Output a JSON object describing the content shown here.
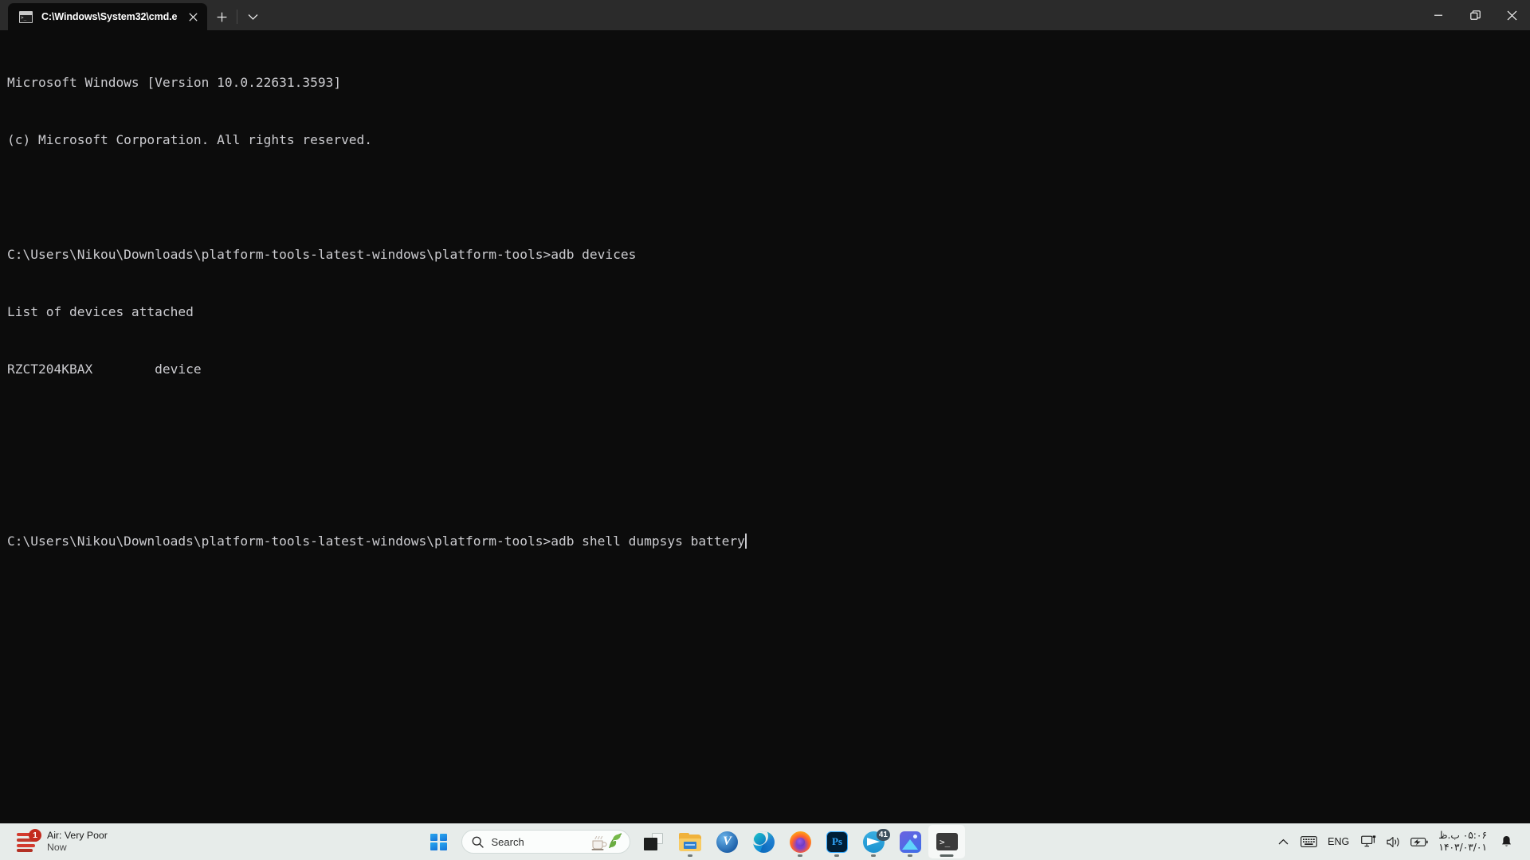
{
  "window": {
    "tab_title": "C:\\Windows\\System32\\cmd.e",
    "tab_icon": "console-icon",
    "new_tab_label": "+",
    "dropdown_label": "v",
    "minimize_label": "Minimize",
    "restore_label": "Restore",
    "close_label": "Close"
  },
  "terminal": {
    "lines": [
      "Microsoft Windows [Version 10.0.22631.3593]",
      "(c) Microsoft Corporation. All rights reserved.",
      "",
      "C:\\Users\\Nikou\\Downloads\\platform-tools-latest-windows\\platform-tools>adb devices",
      "List of devices attached",
      "RZCT204KBAX        device",
      "",
      ""
    ],
    "prompt": "C:\\Users\\Nikou\\Downloads\\platform-tools-latest-windows\\platform-tools>",
    "current_command": "adb shell dumpsys battery",
    "foreground_color": "#ccccd0",
    "background_color": "#0c0c0c"
  },
  "taskbar": {
    "background_color": "#e7ecea",
    "weather": {
      "title": "Air: Very Poor",
      "subtitle": "Now",
      "badge": "1",
      "icon": "haze-icon"
    },
    "start_label": "Start",
    "search": {
      "placeholder": "Search",
      "icon": "search-icon",
      "art": "teacup-and-leaf-illustration"
    },
    "apps": [
      {
        "name": "task-view",
        "label": "Task View",
        "running": false,
        "active": false,
        "badge": ""
      },
      {
        "name": "file-explorer",
        "label": "File Explorer",
        "running": true,
        "active": false,
        "badge": ""
      },
      {
        "name": "v2ray-client",
        "label": "V2RayN",
        "running": false,
        "active": false,
        "badge": ""
      },
      {
        "name": "microsoft-edge",
        "label": "Microsoft Edge",
        "running": false,
        "active": false,
        "badge": ""
      },
      {
        "name": "firefox",
        "label": "Firefox",
        "running": true,
        "active": false,
        "badge": ""
      },
      {
        "name": "photoshop",
        "label": "Adobe Photoshop",
        "running": true,
        "active": false,
        "badge": ""
      },
      {
        "name": "telegram",
        "label": "Telegram",
        "running": true,
        "active": false,
        "badge": "41"
      },
      {
        "name": "photos",
        "label": "Photos",
        "running": true,
        "active": false,
        "badge": ""
      },
      {
        "name": "windows-terminal",
        "label": "Terminal",
        "running": true,
        "active": true,
        "badge": ""
      }
    ],
    "tray": {
      "overflow_label": "Show hidden icons",
      "keyboard_label": "Touch keyboard",
      "language": "ENG",
      "network_label": "Network",
      "volume_label": "Volume",
      "battery_label": "Battery",
      "clock_time": "۰۵:۰۶ ب.ظ",
      "clock_date": "۱۴۰۳/۰۳/۰۱",
      "notifications_label": "Notifications"
    }
  }
}
